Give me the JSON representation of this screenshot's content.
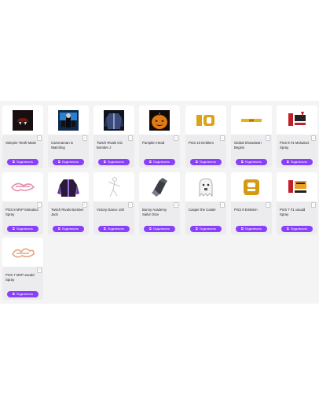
{
  "items": [
    {
      "title": "Vampire Teeth Mask",
      "button": "Подключить",
      "icon": "vampire-mask-icon",
      "badge": "i"
    },
    {
      "title": "Cameraman is Watching",
      "button": "Подключить",
      "icon": "cameraman-icon",
      "badge": "i"
    },
    {
      "title": "Twitch Rivals OG Bomber J",
      "button": "Подключить",
      "icon": "bomber-jacket-icon",
      "badge": "i"
    },
    {
      "title": "Pumpkin Head",
      "button": "Подключить",
      "icon": "pumpkin-icon",
      "badge": "i"
    },
    {
      "title": "PGS 10 Emblem",
      "button": "Подключить",
      "icon": "pgs10-emblem-icon",
      "badge": "i"
    },
    {
      "title": "Global Showdown Begins",
      "button": "Подключить",
      "icon": "showdown-banner-icon",
      "badge": "i"
    },
    {
      "title": "PGS 8 #1 Molodoct Spray",
      "button": "Подключить",
      "icon": "spray-icon",
      "badge": "i"
    },
    {
      "title": "PGS 8 MVP Molodoct Spray",
      "button": "Подключить",
      "icon": "mvp-spray-icon",
      "badge": "i"
    },
    {
      "title": "Twitch Rivals Bomber Jack",
      "button": "Подключить",
      "icon": "jacket-icon",
      "badge": "i"
    },
    {
      "title": "Victory Dance 100",
      "button": "Подключить",
      "icon": "dance-icon",
      "badge": "i"
    },
    {
      "title": "Bunny Academy Sailor Glov",
      "button": "Подключить",
      "icon": "glove-icon",
      "badge": "i"
    },
    {
      "title": "Casper the Caster",
      "button": "Подключить",
      "icon": "ghost-icon",
      "badge": "i"
    },
    {
      "title": "PGS 9 Emblem",
      "button": "Подключить",
      "icon": "pgs9-emblem-icon",
      "badge": "i"
    },
    {
      "title": "PGS 7 #1 xwudd Spray",
      "button": "Подключить",
      "icon": "xwudd-spray-icon",
      "badge": "i"
    },
    {
      "title": "PGS 7 MVP xwudd Spray",
      "button": "Подключить",
      "icon": "xwudd-mvp-spray-icon",
      "badge": "i"
    }
  ],
  "colors": {
    "accent": "#8a3ffc",
    "panel": "#f4f4f5",
    "card": "#ececef"
  }
}
